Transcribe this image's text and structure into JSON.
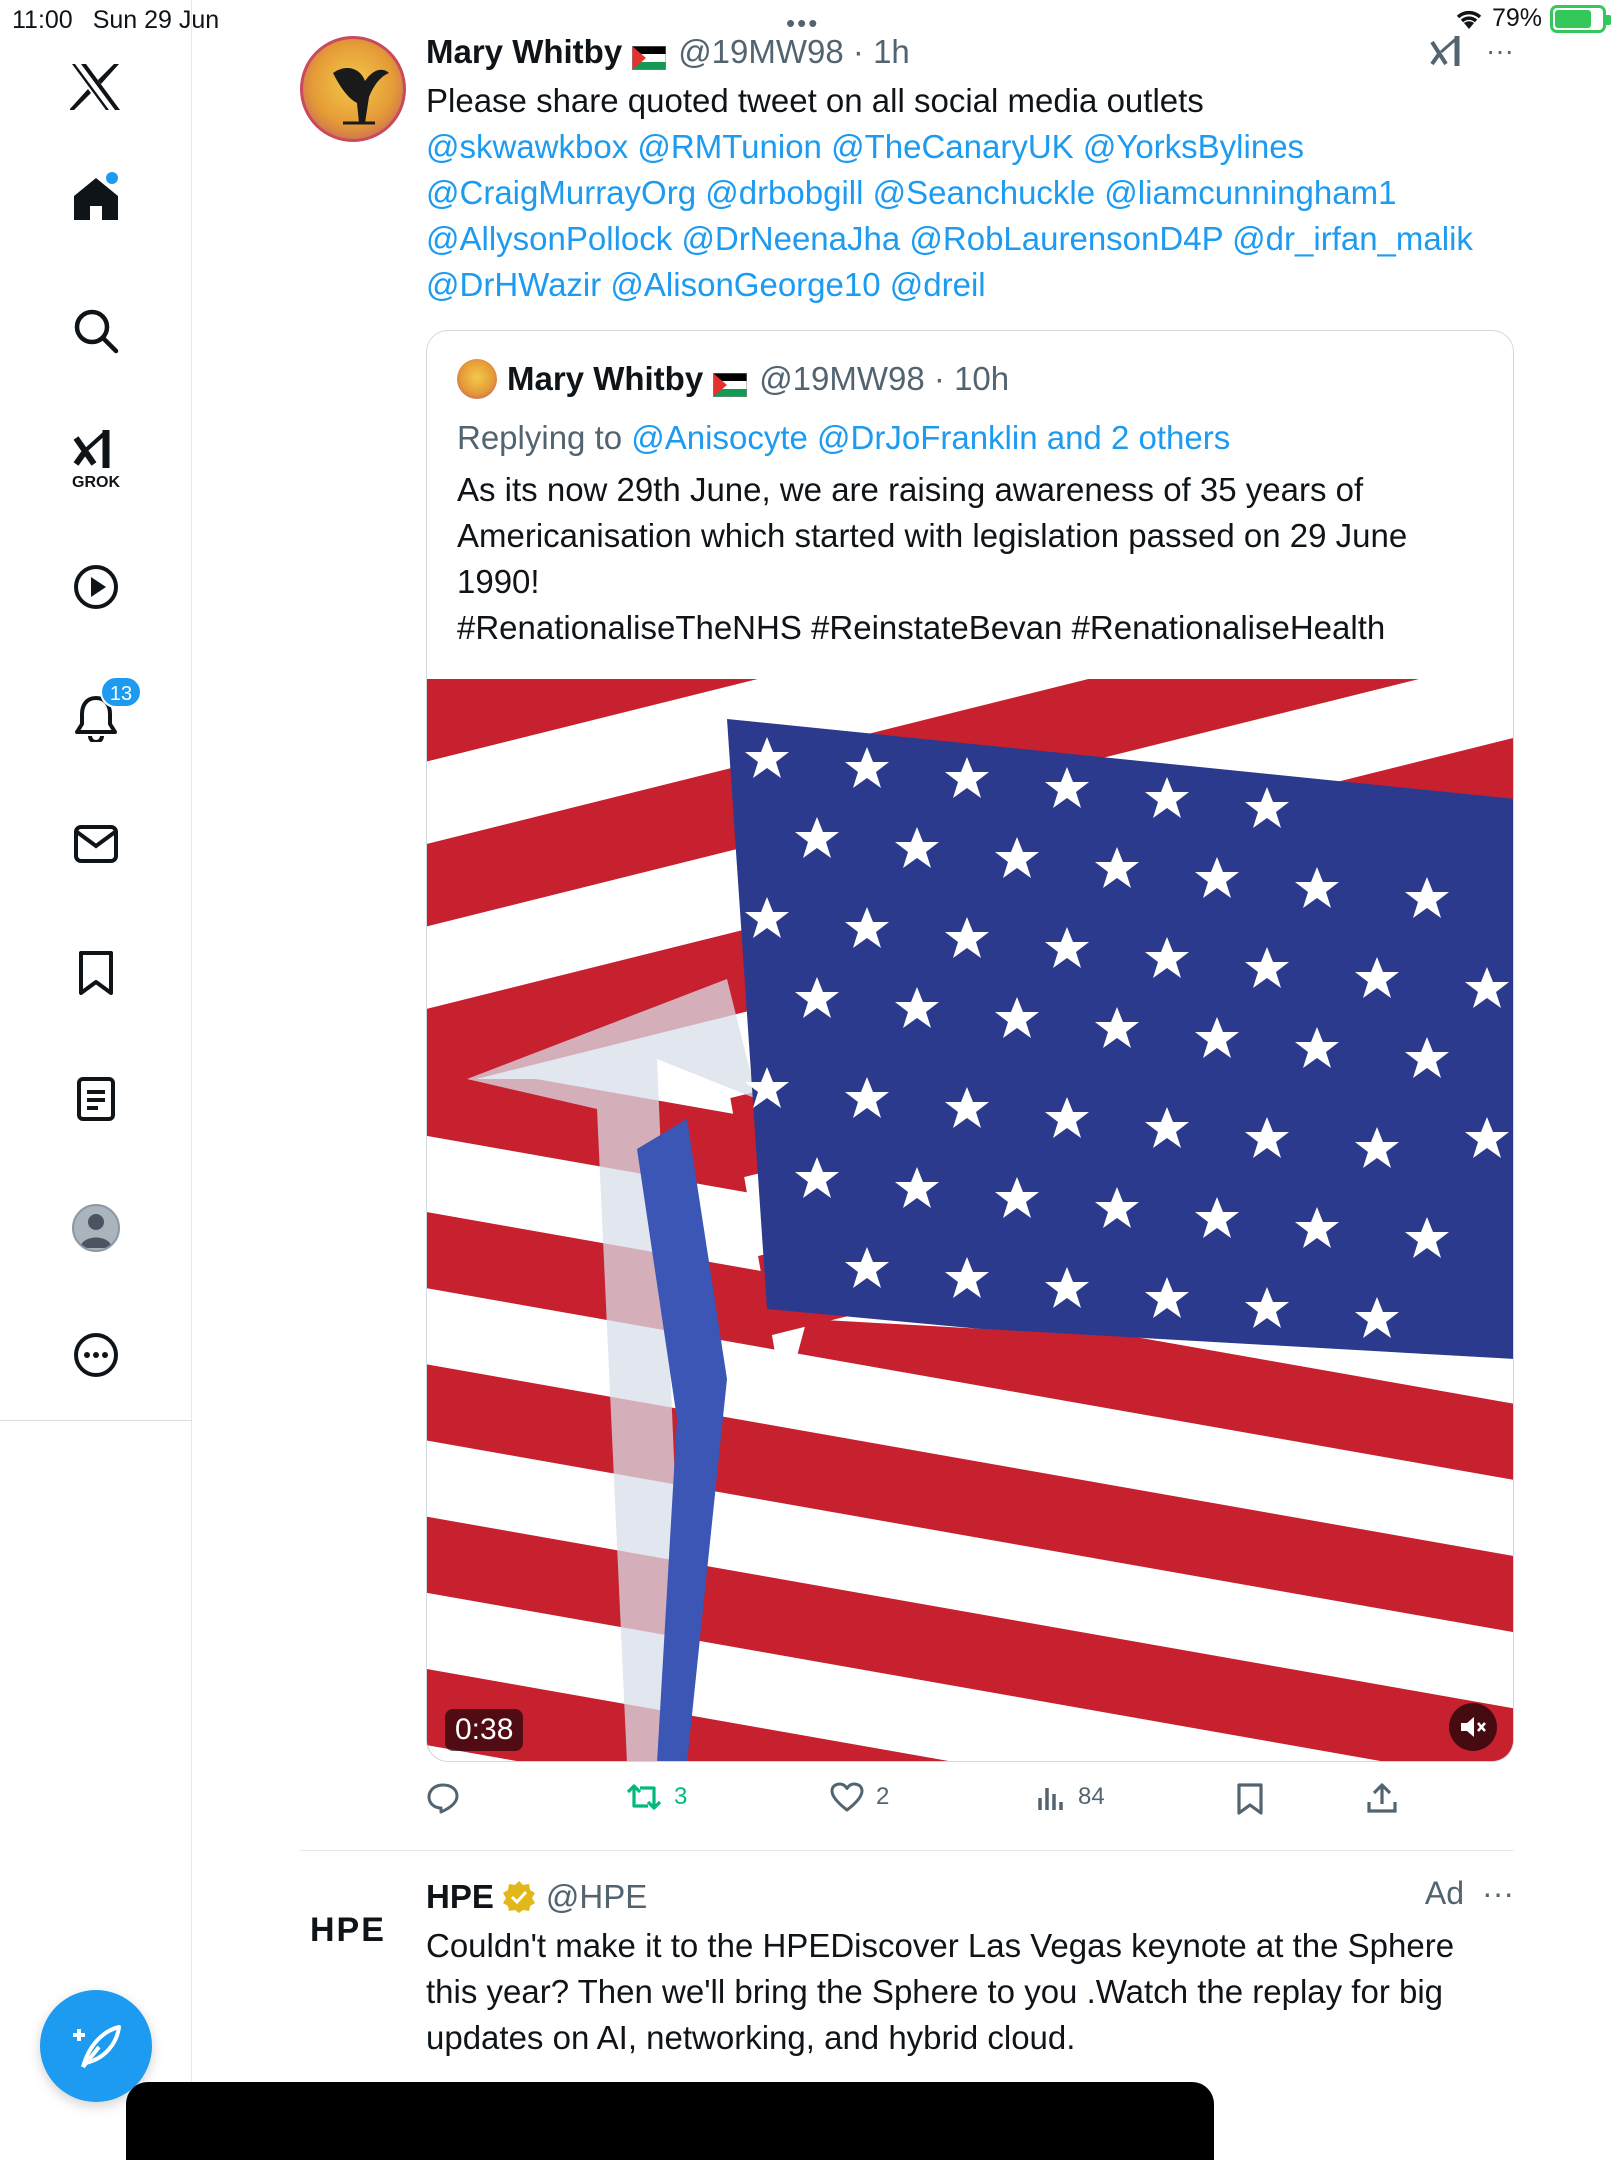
{
  "status_bar": {
    "time": "11:00",
    "date": "Sun 29 Jun",
    "battery": "79%",
    "battery_level": 0.79
  },
  "sidebar": {
    "grok_label": "GROK",
    "notifications_count": "13"
  },
  "tweet": {
    "name": "Mary Whitby",
    "handle": "@19MW98",
    "time": "1h",
    "text_line1": "Please share quoted tweet on all social media outlets",
    "mentions": [
      "@skwawkbox",
      "@RMTunion",
      "@TheCanaryUK",
      "@YorksBylines",
      "@CraigMurrayOrg",
      "@drbobgill",
      "@Seanchuckle",
      "@liamcunningham1",
      "@AllysonPollock",
      "@DrNeenaJha",
      "@RobLaurensonD4P",
      "@dr_irfan_malik",
      "@DrHWazir",
      "@AlisonGeorge10",
      "@dreil"
    ]
  },
  "quote": {
    "name": "Mary Whitby",
    "handle": "@19MW98",
    "time": "10h",
    "replying_to_label": "Replying to",
    "replying_to_users": "@Anisocyte @DrJoFranklin and 2 others",
    "text_line1": "As its  now 29th June, we are raising awareness of 35 years of",
    "text_line2": "Americanisation which started with legislation passed on 29 June",
    "text_line3": "1990!",
    "hashtags": "#RenationaliseTheNHS #ReinstateBevan #RenationaliseHealth",
    "video_duration": "0:38"
  },
  "actions": {
    "replies": "",
    "retweets": "3",
    "likes": "2",
    "views": "84"
  },
  "ad": {
    "logo_text": "HPE",
    "name": "HPE",
    "handle": "@HPE",
    "ad_label": "Ad",
    "text_line1": "Couldn't make it to the HPEDiscover Las Vegas keynote at the Sphere",
    "text_line2": "this year? Then we'll bring the Sphere to you .Watch the replay for big",
    "text_line3": "updates on AI, networking, and hybrid cloud."
  },
  "colors": {
    "accent": "#1d9bf0",
    "secondary_text": "#536471",
    "retweet_green": "#00ba7c",
    "flag_red": "#c7202e",
    "flag_blue": "#2b3a8c"
  }
}
